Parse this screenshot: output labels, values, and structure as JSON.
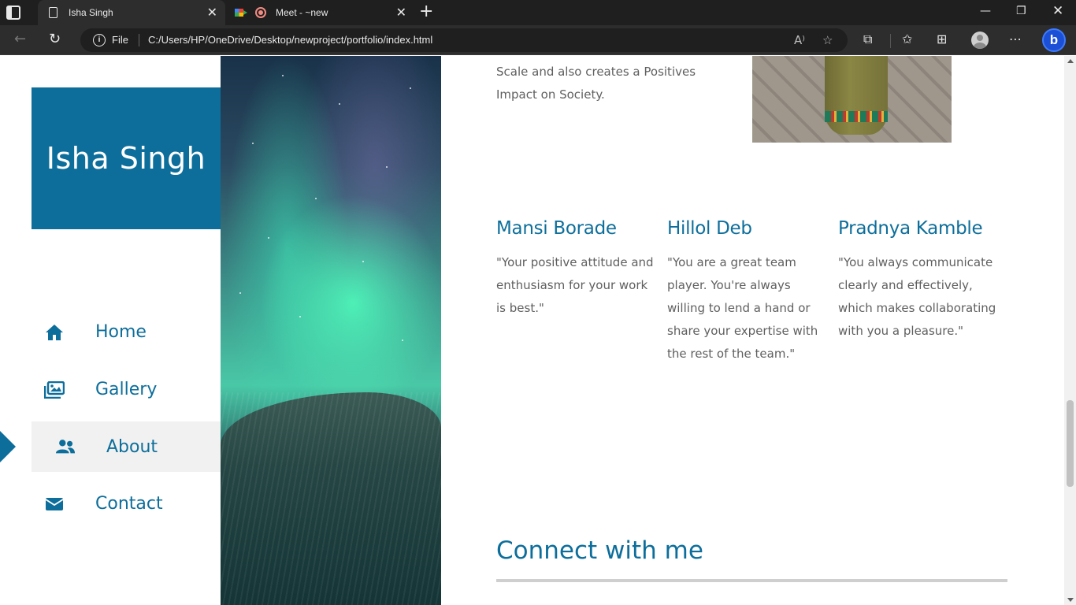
{
  "browser": {
    "tabs": [
      {
        "title": "Isha Singh",
        "active": true
      },
      {
        "title": "Meet - ~new",
        "active": false
      }
    ],
    "address": {
      "scheme_label": "File",
      "url": "C:/Users/HP/OneDrive/Desktop/newproject/portfolio/index.html"
    },
    "icons": [
      "tab-overview-icon",
      "back-icon",
      "refresh-icon",
      "read-aloud-icon",
      "add-favorite-icon",
      "extensions-icon",
      "favorites-icon",
      "collections-icon",
      "profile-icon",
      "more-icon",
      "bing-icon",
      "minimize-icon",
      "restore-icon",
      "close-icon"
    ]
  },
  "site": {
    "brand": "Isha Singh",
    "accent_color": "#0d6e9b",
    "menu": [
      {
        "label": "Home",
        "icon": "home-icon"
      },
      {
        "label": "Gallery",
        "icon": "gallery-icon"
      },
      {
        "label": "About",
        "icon": "users-icon",
        "current": true
      },
      {
        "label": "Contact",
        "icon": "envelope-icon"
      }
    ]
  },
  "main": {
    "intro_text": "Scale and also creates a Positives Impact on Society.",
    "testimonials": [
      {
        "name": "Mansi Borade",
        "quote": "\"Your positive attitude and enthusiasm for your work is best.\""
      },
      {
        "name": "Hillol Deb",
        "quote": "\"You are a great team player. You're always willing to lend a hand or share your expertise with the rest of the team.\""
      },
      {
        "name": "Pradnya Kamble",
        "quote": "\"You always communicate clearly and effectively, which makes collaborating with you a pleasure.\""
      }
    ],
    "connect_title": "Connect with me"
  }
}
